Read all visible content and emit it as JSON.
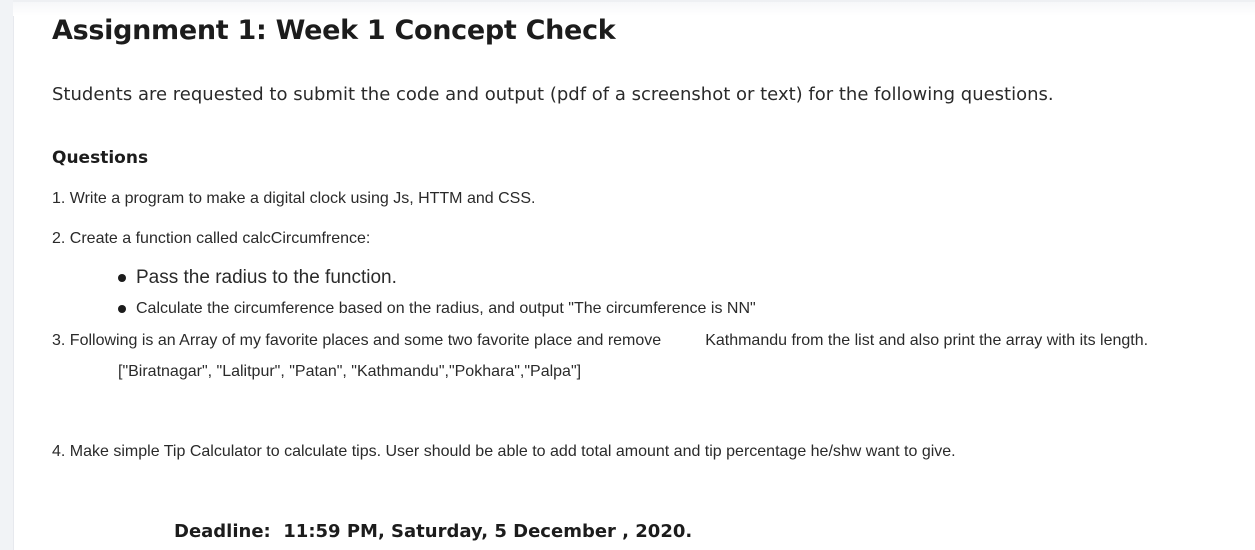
{
  "assignment": {
    "title": "Assignment 1: Week 1 Concept Check",
    "intro": "Students are requested to submit the code and output (pdf of a screenshot or text) for the following questions.",
    "questions_heading": "Questions",
    "questions": [
      {
        "text": "1. Write a program to make a digital clock using Js, HTTM and CSS."
      },
      {
        "text": "2. Create a function called calcCircumfrence:",
        "bullets": [
          "Pass the radius to the function.",
          "Calculate the circumference based on the radius, and output \"The circumference is NN\""
        ]
      },
      {
        "text_part1": "3. Following is an Array of my favorite places and some two favorite place and remove",
        "text_part2": "Kathmandu from the list and also print the array with its length.",
        "array": "[\"Biratnagar\", \"Lalitpur\", \"Patan\", \"Kathmandu\",\"Pokhara\",\"Palpa\"]"
      },
      {
        "text": "4. Make simple Tip Calculator to calculate tips. User should be able to add total amount and tip percentage he/shw want to give."
      }
    ],
    "deadline": "Deadline:  11:59 PM, Saturday, 5 December , 2020."
  }
}
